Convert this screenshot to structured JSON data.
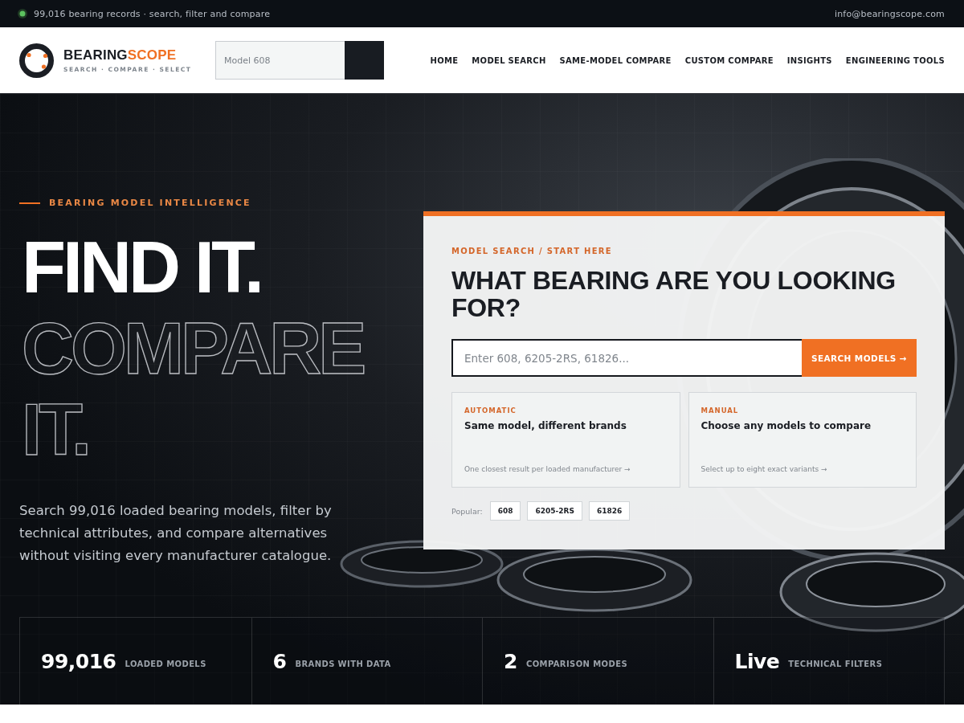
{
  "top_bar": {
    "status": "99,016 bearing records · search, filter and compare",
    "email": "info@bearingscope.com"
  },
  "header": {
    "logo": {
      "name_dark": "BEARING",
      "name_accent": "SCOPE",
      "tagline": "SEARCH · COMPARE · SELECT"
    },
    "search": {
      "placeholder": "Model 608"
    },
    "nav": [
      "HOME",
      "MODEL SEARCH",
      "SAME-MODEL COMPARE",
      "CUSTOM COMPARE",
      "INSIGHTS",
      "ENGINEERING TOOLS"
    ]
  },
  "hero": {
    "eyebrow": "BEARING MODEL INTELLIGENCE",
    "headline": [
      {
        "text": "FIND IT.",
        "kind": "solid"
      },
      {
        "text": "COMPARE IT.",
        "kind": "outline"
      }
    ],
    "description": "Search 99,016 loaded bearing models, filter by technical attributes, and compare alternatives without visiting every manufacturer catalogue."
  },
  "search_card": {
    "eyebrow": "MODEL SEARCH / START HERE",
    "title": "WHAT BEARING ARE YOU LOOKING FOR?",
    "search": {
      "placeholder": "Enter 608, 6205-2RS, 61826...",
      "button": "SEARCH MODELS →"
    },
    "modes": [
      {
        "tag": "AUTOMATIC",
        "title": "Same model, different brands",
        "note": "One closest result per loaded manufacturer →"
      },
      {
        "tag": "MANUAL",
        "title": "Choose any models to compare",
        "note": "Select up to eight exact variants →"
      }
    ],
    "popular": {
      "label": "Popular:",
      "chips": [
        "608",
        "6205-2RS",
        "61826"
      ]
    }
  },
  "stats": [
    {
      "value": "99,016",
      "label": "LOADED MODELS"
    },
    {
      "value": "6",
      "label": "BRANDS WITH DATA"
    },
    {
      "value": "2",
      "label": "COMPARISON MODES"
    },
    {
      "value": "Live",
      "label": "TECHNICAL FILTERS"
    }
  ]
}
